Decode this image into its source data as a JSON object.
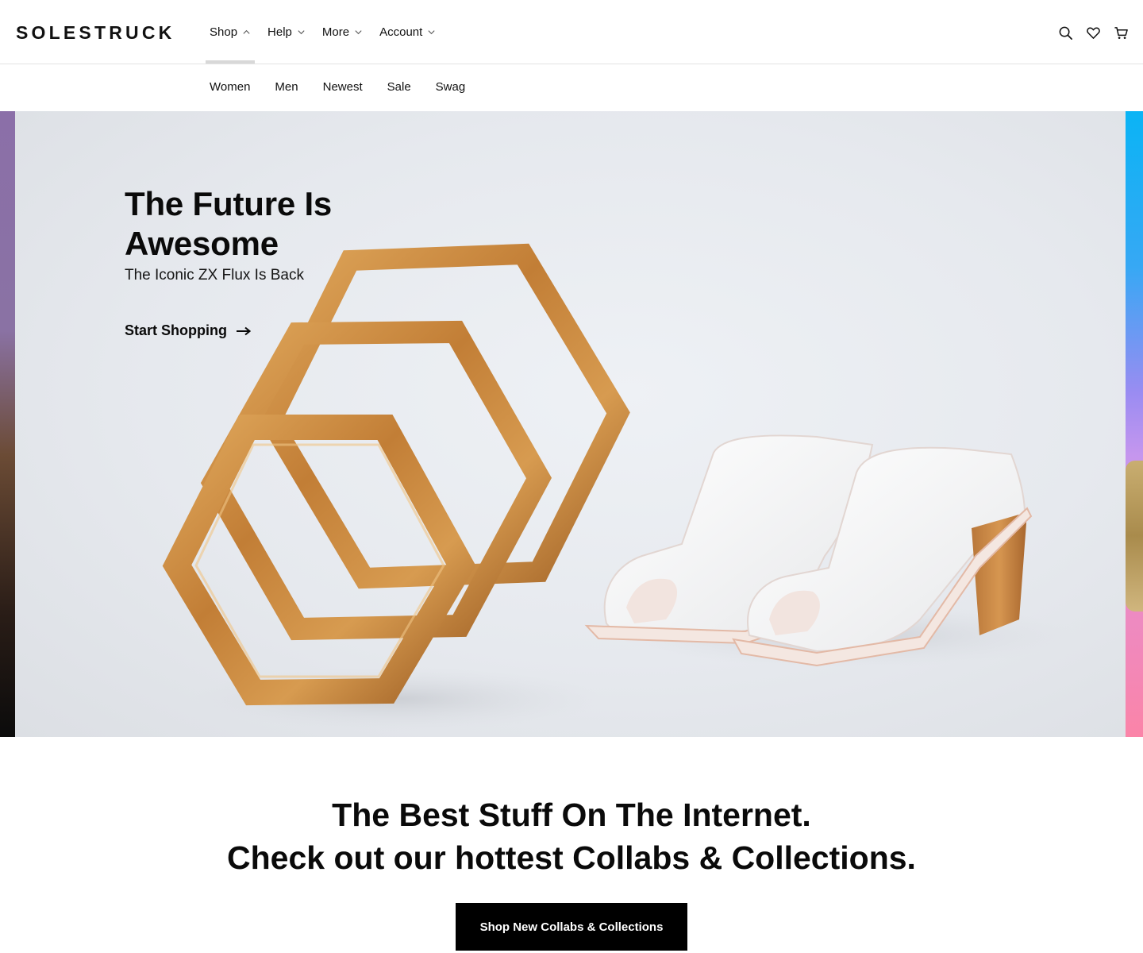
{
  "brand": {
    "logo_text": "SOLESTRUCK"
  },
  "main_nav": [
    {
      "label": "Shop",
      "active": true
    },
    {
      "label": "Help"
    },
    {
      "label": "More"
    },
    {
      "label": "Account"
    }
  ],
  "header_icons": [
    "search-icon",
    "heart-icon",
    "cart-icon"
  ],
  "sub_nav": [
    "Women",
    "Men",
    "Newest",
    "Sale",
    "Swag"
  ],
  "hero": {
    "title": "The Future Is\nAwesome",
    "subtitle": "The Iconic ZX Flux Is Back",
    "cta": "Start Shopping"
  },
  "promo": {
    "line1": "The Best Stuff On The Internet.",
    "line2": "Check out our hottest Collabs & Collections.",
    "button": "Shop New Collabs & Collections"
  },
  "colors": {
    "text": "#111111",
    "button_bg": "#000000",
    "button_text": "#ffffff",
    "active_underline": "#d8d8d8",
    "hero_bg": "#e6e9ee",
    "wood": "#c98a3e"
  }
}
